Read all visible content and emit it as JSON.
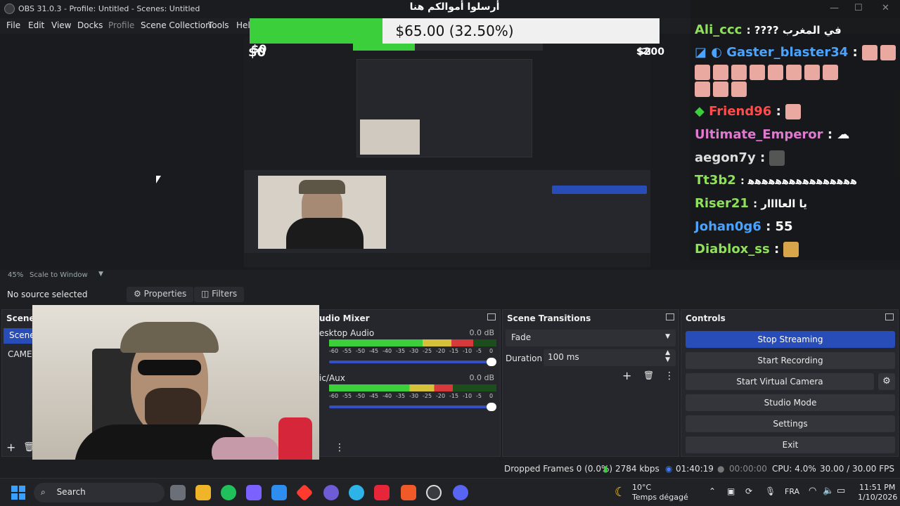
{
  "window": {
    "title": "OBS 31.0.3 - Profile: Untitled - Scenes: Untitled"
  },
  "menu": [
    "File",
    "Edit",
    "View",
    "Docks",
    "Profile",
    "Scene Collection",
    "Tools",
    "Hel"
  ],
  "donation": {
    "heading": "أرسلوا أموالكم هنا",
    "bar_text": "$65.00 (32.50%)",
    "min": "$0",
    "max": "$200",
    "progress": 0.325
  },
  "chat": [
    {
      "user": "Ali_ccc",
      "color": "#8fe05a",
      "text": ": ???? في المغرب"
    },
    {
      "user": "Gaster_blaster34",
      "color": "#4aa3ff",
      "text": ":"
    },
    {
      "user": "Friend96",
      "color": "#ff4d4d",
      "text": ":"
    },
    {
      "user": "Ultimate_Emperor",
      "color": "#e07ad0",
      "text": ":"
    },
    {
      "user": "aegon7y",
      "color": "#dddddd",
      "text": ":"
    },
    {
      "user": "Tt3b2",
      "color": "#8fe05a",
      "text": ": ﻫﻫﻫﻫﻫﻫﻫﻫﻫﻫﻫﻫﻫﻫﻫﻫ"
    },
    {
      "user": "Riser21",
      "color": "#8fe05a",
      "text": ": يا العاااار"
    },
    {
      "user": "Johan0g6",
      "color": "#4aa3ff",
      "text": ": 55"
    },
    {
      "user": "Diablox_ss",
      "color": "#8fe05a",
      "text": ":"
    }
  ],
  "zoom": {
    "level": "45%",
    "mode": "Scale to Window"
  },
  "sources": {
    "none": "No source selected",
    "properties": "Properties",
    "filters": "Filters"
  },
  "scenes": {
    "title": "Scenes",
    "items": [
      "Scene",
      "CAMER"
    ]
  },
  "mixer": {
    "title": "udio Mixer",
    "channels": [
      {
        "name": "esktop Audio",
        "db": "0.0 dB",
        "level": 0.86
      },
      {
        "name": "ic/Aux",
        "db": "0.0 dB",
        "level": 0.74
      }
    ],
    "ticks": [
      "-60",
      "-55",
      "-50",
      "-45",
      "-40",
      "-35",
      "-30",
      "-25",
      "-20",
      "-15",
      "-10",
      "-5",
      "0"
    ]
  },
  "transitions": {
    "title": "Scene Transitions",
    "selected": "Fade",
    "duration_label": "Duration",
    "duration": "100 ms"
  },
  "controls": {
    "title": "Controls",
    "buttons": [
      "Stop Streaming",
      "Start Recording",
      "Start Virtual Camera",
      "Studio Mode",
      "Settings",
      "Exit"
    ]
  },
  "status": {
    "dropped": "Dropped Frames 0 (0.0%)",
    "kbps": "2784 kbps",
    "stream_time": "01:40:19",
    "rec_time": "00:00:00",
    "cpu": "CPU: 4.0%",
    "fps": "30.00 / 30.00 FPS"
  },
  "taskbar": {
    "search": "Search",
    "weather_temp": "10°C",
    "weather_desc": "Temps dégagé",
    "lang": "FRA",
    "time": "11:51 PM",
    "date": "1/10/2026"
  },
  "colors": {
    "accent": "#284cb8",
    "green": "#3ccf3c",
    "panel": "#26272c"
  }
}
